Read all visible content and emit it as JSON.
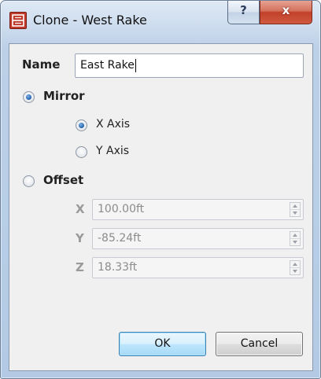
{
  "window": {
    "title": "Clone - West Rake",
    "help_label": "?",
    "close_label": "x",
    "app_icon": "clone-app-icon",
    "help_icon": "question-icon",
    "close_icon": "close-icon"
  },
  "name": {
    "label": "Name",
    "value": "East Rake"
  },
  "mirror": {
    "label": "Mirror",
    "selected": true,
    "options": [
      {
        "label": "X Axis",
        "selected": true
      },
      {
        "label": "Y Axis",
        "selected": false
      }
    ]
  },
  "offset": {
    "label": "Offset",
    "selected": false,
    "fields": [
      {
        "label": "X",
        "value": "100.00ft"
      },
      {
        "label": "Y",
        "value": "-85.24ft"
      },
      {
        "label": "Z",
        "value": "18.33ft"
      }
    ]
  },
  "buttons": {
    "ok_label": "OK",
    "cancel_label": "Cancel"
  }
}
